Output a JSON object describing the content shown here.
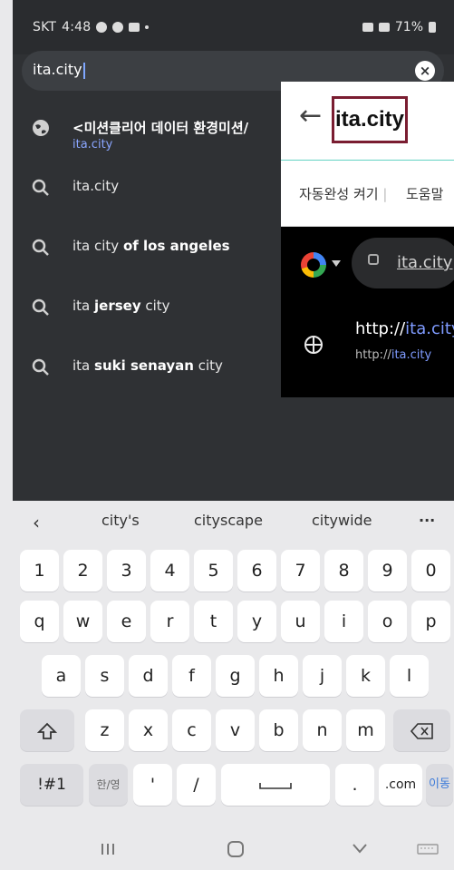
{
  "status": {
    "carrier": "SKT",
    "time": "4:48",
    "battery": "71%"
  },
  "search": {
    "value": "ita.city"
  },
  "suggestions": [
    {
      "title_plain": "<미션클리어 데이터 환경미션/",
      "subtitle": "ita.city",
      "icon": "globe-icon"
    },
    {
      "title_plain": "ita.city",
      "icon": "search-icon"
    },
    {
      "title_prefix": "ita city ",
      "title_bold": "of los angeles",
      "icon": "search-icon"
    },
    {
      "title_prefix": "ita ",
      "title_bold": "jersey",
      "title_suffix": " city",
      "icon": "search-icon"
    },
    {
      "title_prefix": "ita ",
      "title_bold": "suki senayan",
      "title_suffix": " city",
      "icon": "search-icon"
    }
  ],
  "overlay": {
    "highlight_text": "ita.city",
    "autocomplete_off": "자동완성 켜기",
    "help": "도움말",
    "url_bar_text": "ita.city",
    "result_title_prefix": "http://",
    "result_title_highlight": "ita.city",
    "result_sub_prefix": "http://",
    "result_sub_highlight": "ita.city"
  },
  "keyboard": {
    "predictions": [
      "city's",
      "cityscape",
      "citywide"
    ],
    "row_numbers": [
      "1",
      "2",
      "3",
      "4",
      "5",
      "6",
      "7",
      "8",
      "9",
      "0"
    ],
    "row1": [
      "q",
      "w",
      "e",
      "r",
      "t",
      "y",
      "u",
      "i",
      "o",
      "p"
    ],
    "row2": [
      "a",
      "s",
      "d",
      "f",
      "g",
      "h",
      "j",
      "k",
      "l"
    ],
    "row3": [
      "z",
      "x",
      "c",
      "v",
      "b",
      "n",
      "m"
    ],
    "symbols": "!#1",
    "lang_key": "한/영",
    "apostrophe": "'",
    "slash": "/",
    "dot": ".",
    "dotcom": ".com",
    "go": "이동"
  },
  "colors": {
    "accent": "#8aa6ff",
    "highlight_box": "#7a1d31"
  }
}
